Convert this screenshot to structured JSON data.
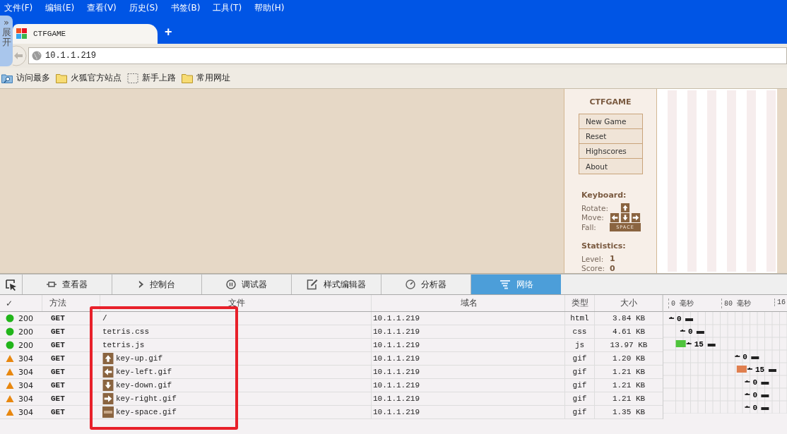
{
  "menu_bar": {
    "items": [
      "文件(F)",
      "编辑(E)",
      "查看(V)",
      "历史(S)",
      "书签(B)",
      "工具(T)",
      "帮助(H)"
    ]
  },
  "sidebar_toggle": {
    "arrow": "»",
    "label": "展开"
  },
  "tabs": [
    {
      "title": "CTFGAME",
      "selected": true
    }
  ],
  "new_tab": {
    "label": "+"
  },
  "address_bar": {
    "value": "10.1.1.219"
  },
  "bookmarks": [
    {
      "label": "访问最多",
      "kind": "smart"
    },
    {
      "label": "火狐官方站点",
      "kind": "folder"
    },
    {
      "label": "新手上路",
      "kind": "empty"
    },
    {
      "label": "常用网址",
      "kind": "folder"
    }
  ],
  "game": {
    "title": "CTFGAME",
    "menu": [
      "New Game",
      "Reset",
      "Highscores",
      "About"
    ],
    "keyboard": {
      "heading": "Keyboard:",
      "rows": [
        "Rotate:",
        "Move:",
        "Fall:"
      ],
      "space_key": "SPACE"
    },
    "statistics": {
      "heading": "Statistics:",
      "rows": [
        {
          "label": "Level:",
          "value": "1"
        },
        {
          "label": "Score:",
          "value": "0"
        }
      ]
    }
  },
  "devtools": {
    "tabs": [
      {
        "label": "查看器",
        "selected": false
      },
      {
        "label": "控制台",
        "selected": false
      },
      {
        "label": "调试器",
        "selected": false
      },
      {
        "label": "样式编辑器",
        "selected": false
      },
      {
        "label": "分析器",
        "selected": false
      },
      {
        "label": "网络",
        "selected": true
      }
    ],
    "network": {
      "columns": [
        "✓",
        "方法",
        "文件",
        "域名",
        "类型",
        "大小"
      ],
      "timeline_ticks": [
        "0 毫秒",
        "80 毫秒",
        "16"
      ],
      "rows": [
        {
          "status": "200",
          "kind": "ok",
          "method": "GET",
          "file": "/",
          "domain": "10.1.1.219",
          "type": "html",
          "size": "3.84 KB",
          "time": "0",
          "level": 0.04
        },
        {
          "status": "200",
          "kind": "ok",
          "method": "GET",
          "file": "tetris.css",
          "domain": "10.1.1.219",
          "type": "css",
          "size": "4.61 KB",
          "time": "0",
          "level": 0.13
        },
        {
          "status": "200",
          "kind": "ok",
          "method": "GET",
          "file": "tetris.js",
          "domain": "10.1.1.219",
          "type": "js",
          "size": "13.97 KB",
          "time": "15",
          "level": 0.1,
          "color": "#4fc43c"
        },
        {
          "status": "304",
          "kind": "cached",
          "method": "GET",
          "file": "key-up.gif",
          "domain": "10.1.1.219",
          "type": "gif",
          "size": "1.20 KB",
          "time": "0",
          "level": 0.57
        },
        {
          "status": "304",
          "kind": "cached",
          "method": "GET",
          "file": "key-left.gif",
          "domain": "10.1.1.219",
          "type": "gif",
          "size": "1.21 KB",
          "time": "15",
          "level": 0.59,
          "color": "#e07f4f"
        },
        {
          "status": "304",
          "kind": "cached",
          "method": "GET",
          "file": "key-down.gif",
          "domain": "10.1.1.219",
          "type": "gif",
          "size": "1.21 KB",
          "time": "0",
          "level": 0.65
        },
        {
          "status": "304",
          "kind": "cached",
          "method": "GET",
          "file": "key-right.gif",
          "domain": "10.1.1.219",
          "type": "gif",
          "size": "1.21 KB",
          "time": "0",
          "level": 0.65
        },
        {
          "status": "304",
          "kind": "cached",
          "method": "GET",
          "file": "key-space.gif",
          "domain": "10.1.1.219",
          "type": "gif",
          "size": "1.35 KB",
          "time": "0",
          "level": 0.65
        }
      ]
    }
  }
}
